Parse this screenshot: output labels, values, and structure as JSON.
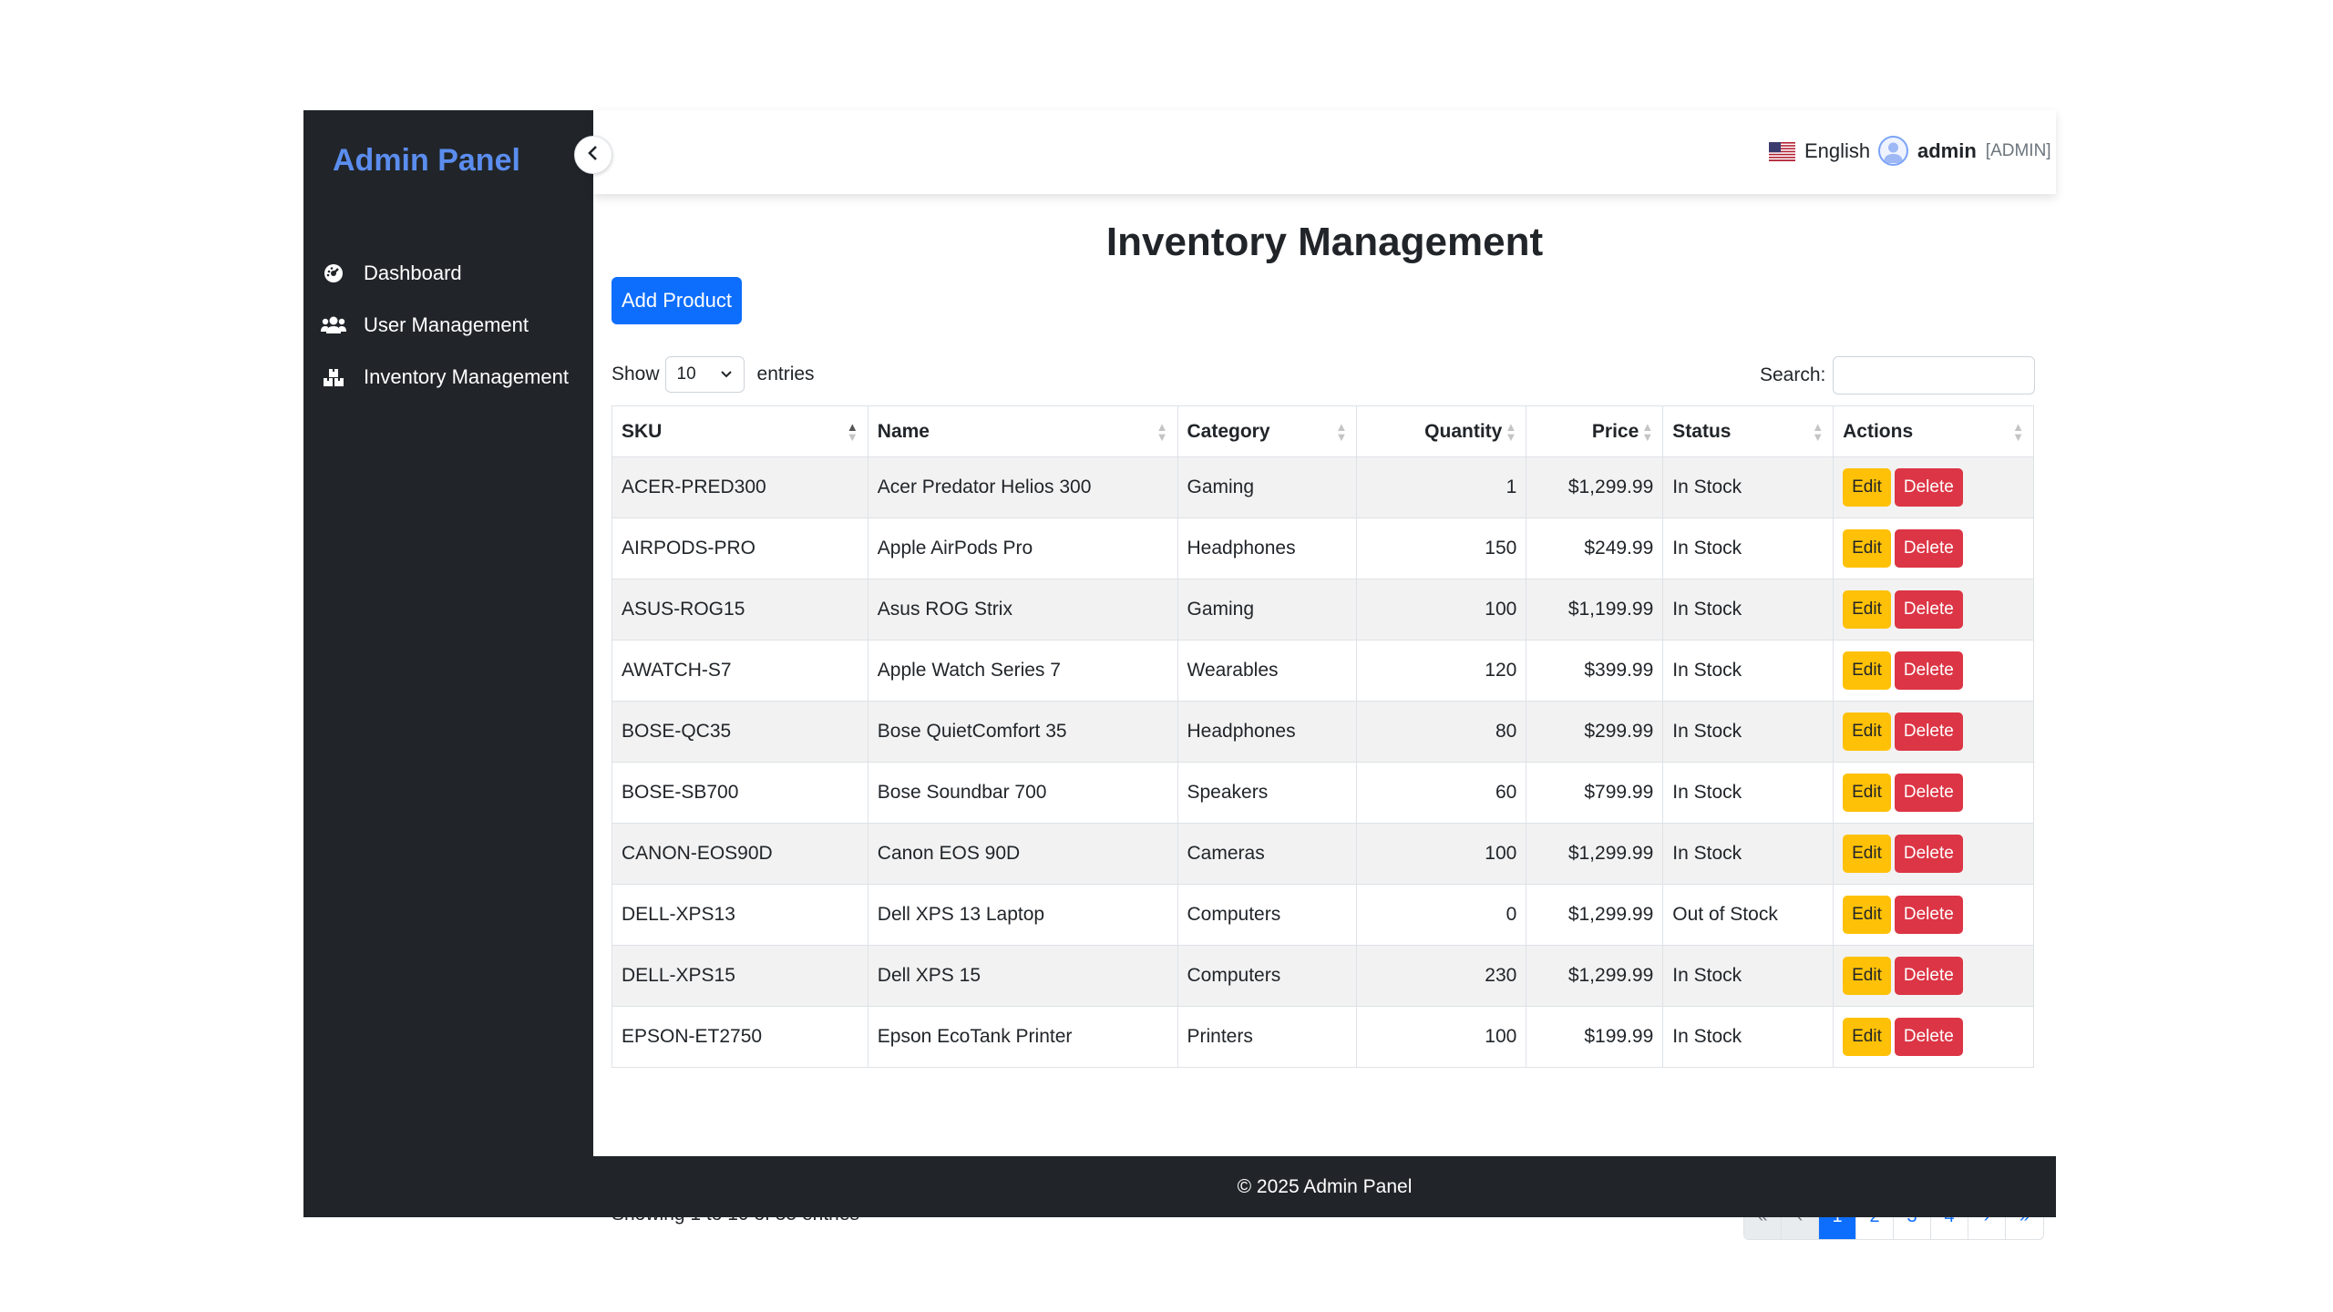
{
  "brand": "Admin Panel",
  "sidebar": {
    "items": [
      {
        "label": "Dashboard",
        "icon": "dashboard-gauge-icon"
      },
      {
        "label": "User Management",
        "icon": "users-icon"
      },
      {
        "label": "Inventory Management",
        "icon": "boxes-icon"
      }
    ]
  },
  "topbar": {
    "language": "English",
    "username": "admin",
    "role": "[ADMIN]"
  },
  "page": {
    "title": "Inventory Management",
    "add_button": "Add Product"
  },
  "table_controls": {
    "show_label": "Show",
    "entries_value": "10",
    "entries_label": "entries",
    "search_label": "Search:",
    "search_value": ""
  },
  "table": {
    "headers": [
      "SKU",
      "Name",
      "Category",
      "Quantity",
      "Price",
      "Status",
      "Actions"
    ],
    "rows": [
      {
        "sku": "ACER-PRED300",
        "name": "Acer Predator Helios 300",
        "category": "Gaming",
        "quantity": "1",
        "price": "$1,299.99",
        "status": "In Stock"
      },
      {
        "sku": "AIRPODS-PRO",
        "name": "Apple AirPods Pro",
        "category": "Headphones",
        "quantity": "150",
        "price": "$249.99",
        "status": "In Stock"
      },
      {
        "sku": "ASUS-ROG15",
        "name": "Asus ROG Strix",
        "category": "Gaming",
        "quantity": "100",
        "price": "$1,199.99",
        "status": "In Stock"
      },
      {
        "sku": "AWATCH-S7",
        "name": "Apple Watch Series 7",
        "category": "Wearables",
        "quantity": "120",
        "price": "$399.99",
        "status": "In Stock"
      },
      {
        "sku": "BOSE-QC35",
        "name": "Bose QuietComfort 35",
        "category": "Headphones",
        "quantity": "80",
        "price": "$299.99",
        "status": "In Stock"
      },
      {
        "sku": "BOSE-SB700",
        "name": "Bose Soundbar 700",
        "category": "Speakers",
        "quantity": "60",
        "price": "$799.99",
        "status": "In Stock"
      },
      {
        "sku": "CANON-EOS90D",
        "name": "Canon EOS 90D",
        "category": "Cameras",
        "quantity": "100",
        "price": "$1,299.99",
        "status": "In Stock"
      },
      {
        "sku": "DELL-XPS13",
        "name": "Dell XPS 13 Laptop",
        "category": "Computers",
        "quantity": "0",
        "price": "$1,299.99",
        "status": "Out of Stock"
      },
      {
        "sku": "DELL-XPS15",
        "name": "Dell XPS 15",
        "category": "Computers",
        "quantity": "230",
        "price": "$1,299.99",
        "status": "In Stock"
      },
      {
        "sku": "EPSON-ET2750",
        "name": "Epson EcoTank Printer",
        "category": "Printers",
        "quantity": "100",
        "price": "$199.99",
        "status": "In Stock"
      }
    ],
    "edit_label": "Edit",
    "delete_label": "Delete"
  },
  "info": "Showing 1 to 10 of 35 entries",
  "pagination": [
    "«",
    "‹",
    "1",
    "2",
    "3",
    "4",
    "›",
    "»"
  ],
  "pagination_active": "1",
  "footer": "© 2025 Admin Panel",
  "colors": {
    "sidebar_bg": "#212529",
    "brand": "#5b8def",
    "primary": "#0d6efd",
    "warning": "#ffc107",
    "danger": "#dc3545"
  }
}
